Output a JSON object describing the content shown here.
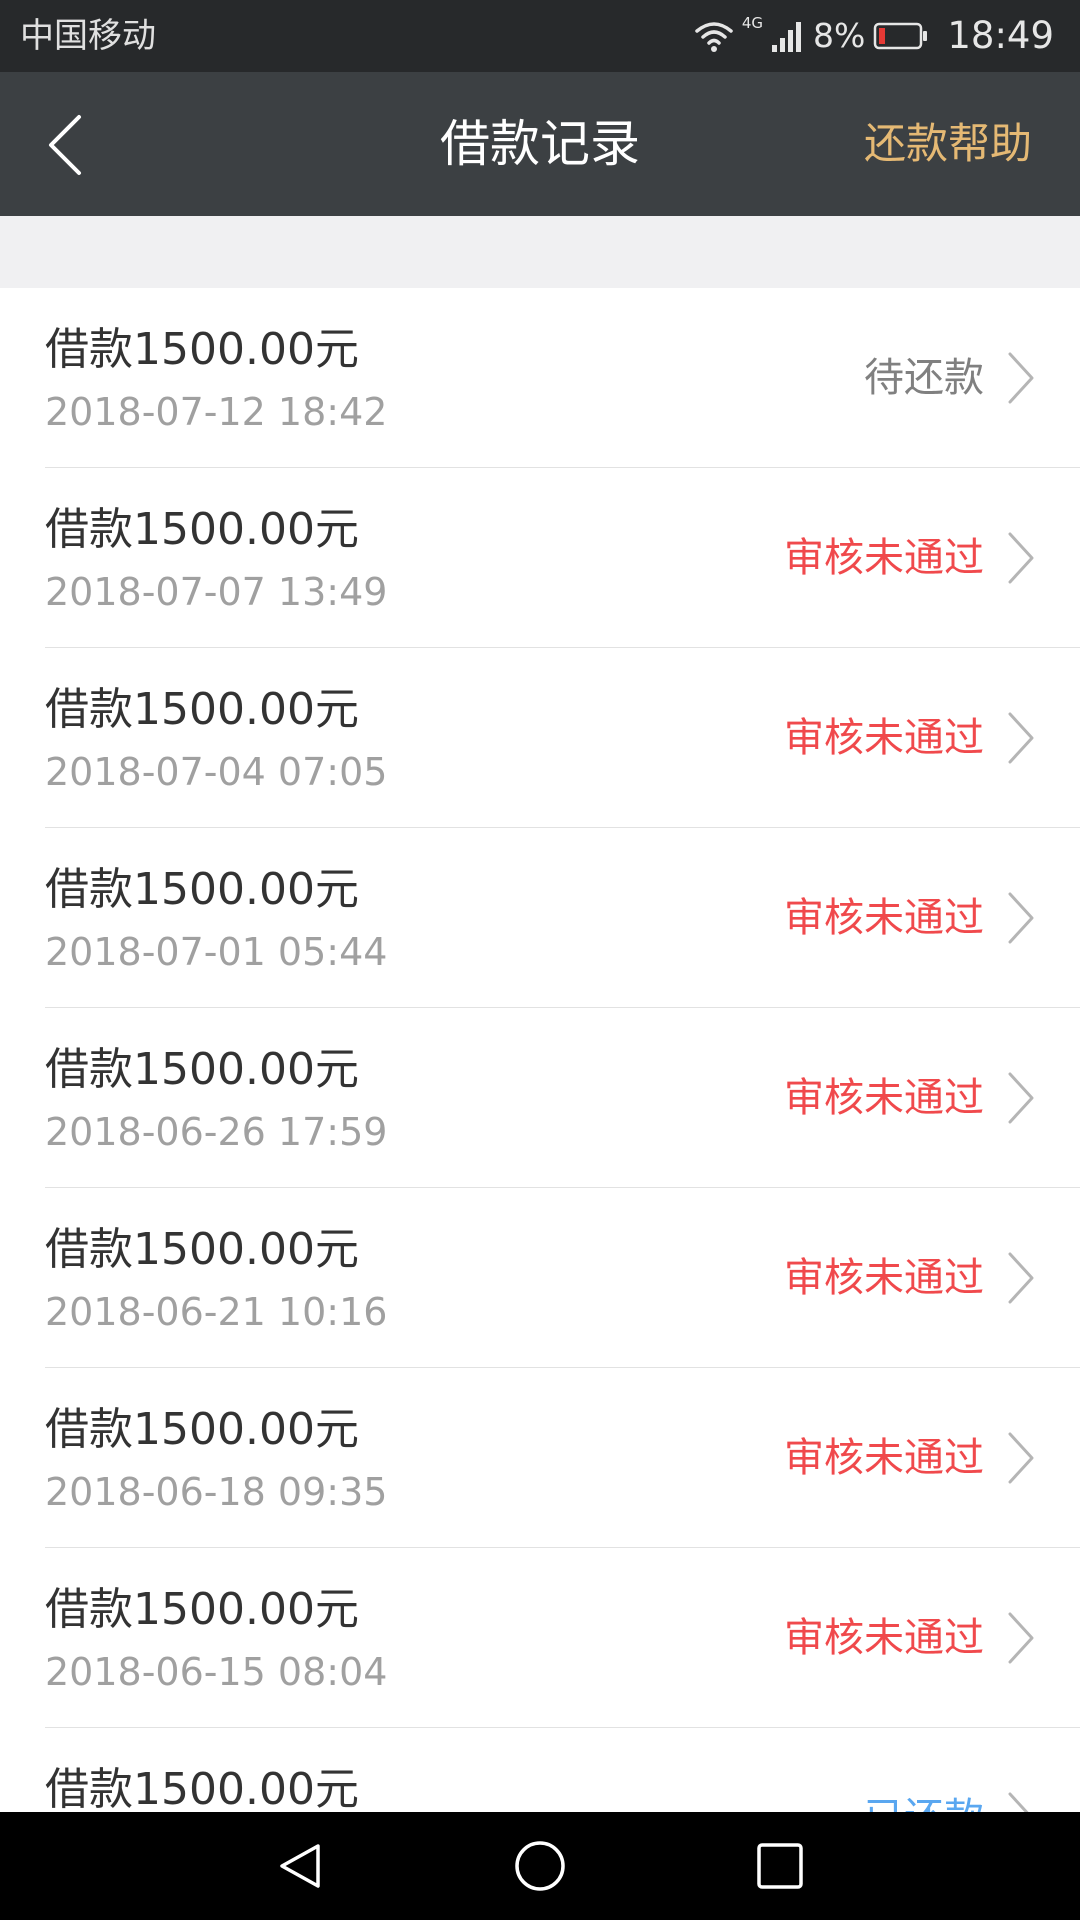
{
  "status_bar": {
    "carrier": "中国移动",
    "network": "4G",
    "battery": "8%",
    "time": "18:49"
  },
  "header": {
    "title": "借款记录",
    "help_label": "还款帮助"
  },
  "records": [
    {
      "amount": "借款1500.00元",
      "time": "2018-07-12 18:42",
      "status": "待还款",
      "status_type": "pending"
    },
    {
      "amount": "借款1500.00元",
      "time": "2018-07-07 13:49",
      "status": "审核未通过",
      "status_type": "rejected"
    },
    {
      "amount": "借款1500.00元",
      "time": "2018-07-04 07:05",
      "status": "审核未通过",
      "status_type": "rejected"
    },
    {
      "amount": "借款1500.00元",
      "time": "2018-07-01 05:44",
      "status": "审核未通过",
      "status_type": "rejected"
    },
    {
      "amount": "借款1500.00元",
      "time": "2018-06-26 17:59",
      "status": "审核未通过",
      "status_type": "rejected"
    },
    {
      "amount": "借款1500.00元",
      "time": "2018-06-21 10:16",
      "status": "审核未通过",
      "status_type": "rejected"
    },
    {
      "amount": "借款1500.00元",
      "time": "2018-06-18 09:35",
      "status": "审核未通过",
      "status_type": "rejected"
    },
    {
      "amount": "借款1500.00元",
      "time": "2018-06-15 08:04",
      "status": "审核未通过",
      "status_type": "rejected"
    },
    {
      "amount": "借款1500.00元",
      "time": "",
      "status": "已还款",
      "status_type": "repaid"
    }
  ],
  "colors": {
    "status_bar_bg": "#27292b",
    "nav_bar_bg": "#3c4043",
    "help_link": "#e5b974",
    "status_pending": "#808080",
    "status_rejected": "#f0494c",
    "status_repaid": "#5aa7f0"
  },
  "icons": {
    "back": "chevron-left-icon",
    "row": "chevron-right-icon",
    "wifi": "wifi-icon",
    "signal": "signal-icon",
    "battery": "battery-icon",
    "sys_back": "triangle-back-icon",
    "sys_home": "circle-home-icon",
    "sys_recent": "square-recent-icon"
  }
}
